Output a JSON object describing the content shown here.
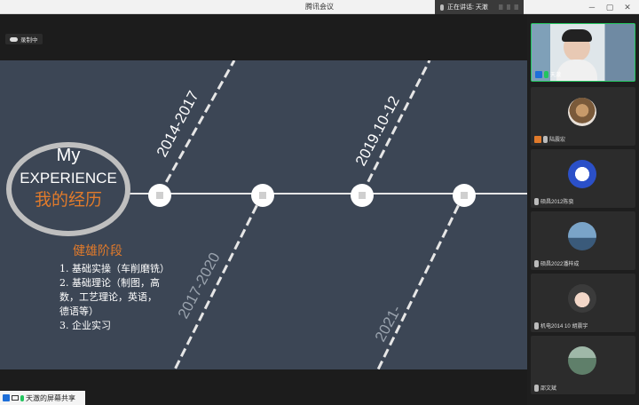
{
  "window": {
    "title": "腾讯会议"
  },
  "speaking": {
    "label": "正在讲话: 天澈"
  },
  "recording": {
    "label": "录制中"
  },
  "share_bar": {
    "label": "天澈的屏幕共享"
  },
  "slide": {
    "circle_line1": "My",
    "circle_line2": "EXPERIENCE",
    "circle_line3": "我的经历",
    "dates_top": [
      "2014-2017",
      "2019.10-12"
    ],
    "dates_bottom": [
      "2017-2020",
      "2021-"
    ],
    "stage_title": "健雄阶段",
    "items": [
      "1. 基础实操（车削磨铣）",
      "2. 基础理论（制图，高",
      "数，工艺理论，英语，",
      "德语等）",
      "3. 企业实习"
    ],
    "colors": {
      "background": "#3c4655",
      "accent": "#e07a2b",
      "line": "#e6e6e6"
    }
  },
  "participants": [
    {
      "name": "天澈",
      "badge": "host-blue",
      "mic": "on"
    },
    {
      "name": "陆震宏",
      "badge": "host-orange",
      "mic": "off"
    },
    {
      "name": "硕昌2012陈骁",
      "badge": "none",
      "mic": "off"
    },
    {
      "name": "硕昌2022潘梓成",
      "badge": "none",
      "mic": "off"
    },
    {
      "name": "机电2014 10 胡震宇",
      "badge": "none",
      "mic": "off"
    },
    {
      "name": "邵文斌",
      "badge": "none",
      "mic": "off"
    }
  ]
}
